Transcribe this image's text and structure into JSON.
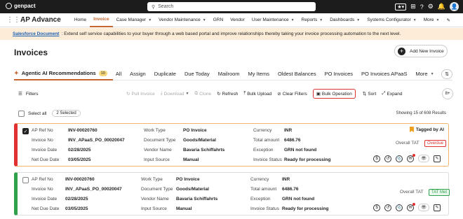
{
  "topbar": {
    "brand": "genpact",
    "search_placeholder": "Search",
    "user_initial": "",
    "grid_label": "☰"
  },
  "nav": {
    "app_title": "AP Advance",
    "items": [
      {
        "label": "Home"
      },
      {
        "label": "Invoice"
      },
      {
        "label": "Case Manager"
      },
      {
        "label": "Vendor Maintenance"
      },
      {
        "label": "GRN"
      },
      {
        "label": "Vendor"
      },
      {
        "label": "User Maintenance"
      },
      {
        "label": "Reports"
      },
      {
        "label": "Dashboards"
      },
      {
        "label": "Systems Configurator"
      },
      {
        "label": "More"
      }
    ]
  },
  "banner": {
    "link": "Salesforce Document",
    "text": ": Extend self service capabilities to your buyer through a web based portal and improve relationships thereby taking your invoice processing automation to the next level."
  },
  "page": {
    "title": "Invoices",
    "add_button": "Add New Invoice"
  },
  "tabs": [
    {
      "label": "Agentic AI Recommendations",
      "count": "10"
    },
    {
      "label": "All"
    },
    {
      "label": "Assign"
    },
    {
      "label": "Duplicate"
    },
    {
      "label": "Due Today"
    },
    {
      "label": "Mailroom"
    },
    {
      "label": "My Items"
    },
    {
      "label": "Oldest Balances"
    },
    {
      "label": "PO Invoices"
    },
    {
      "label": "PO Invoices APaaS"
    },
    {
      "label": "More"
    }
  ],
  "toolbar": {
    "filters": "Filters",
    "pull_invoice": "Pull Invoice",
    "download": "Download",
    "clone": "Clone",
    "refresh": "Refresh",
    "bulk_upload": "Bulk Upload",
    "clear_filters": "Clear Filters",
    "bulk_operation": "Bulk Operation",
    "sort": "Sort",
    "expand": "Expand",
    "more_count": "8+"
  },
  "selection": {
    "select_all": "Select all",
    "selected": "2 Selected",
    "showing": "Showing 15 of 608 Results"
  },
  "labels": {
    "ap_ref": "AP Ref No",
    "invoice_no": "Invoice No",
    "invoice_date": "Invoice Date",
    "net_due": "Net Due Date",
    "work_type": "Work Type",
    "doc_type": "Document Type",
    "vendor_name": "Vendor Name",
    "input_source": "Input Source",
    "currency": "Currency",
    "total_amount": "Total amount",
    "exception": "Exception",
    "invoice_status": "Invoice Status",
    "overall_tat": "Overall TAT",
    "tagged_ai": "Tagged by AI"
  },
  "cards": [
    {
      "ap_ref": "INV-00020760",
      "invoice_no": "INV_APaaS_PO_00020047",
      "invoice_date": "02/28/2025",
      "net_due": "03/05/2025",
      "work_type": "PO Invoice",
      "doc_type": "Goods/Material",
      "vendor_name": "Bavaria Schiffahrts",
      "input_source": "Manual",
      "currency": "INR",
      "total_amount": "6486.76",
      "exception": "GRN not found",
      "invoice_status": "Ready for processing",
      "tat": "Overdue"
    },
    {
      "ap_ref": "INV-00020760",
      "invoice_no": "INV_APaaS_PO_00020047",
      "invoice_date": "02/28/2025",
      "net_due": "03/05/2025",
      "work_type": "PO Invoice",
      "doc_type": "Goods/Material",
      "vendor_name": "Bavaria Schiffahrts",
      "input_source": "Manual",
      "currency": "INR",
      "total_amount": "6486.76",
      "exception": "GRN not found",
      "invoice_status": "Ready for processing",
      "tat": "TAT Met"
    }
  ],
  "colors": {
    "accent": "#c5652f",
    "overdue": "#e03030",
    "met": "#2ea14a",
    "banner_bg": "#fdecd7"
  }
}
